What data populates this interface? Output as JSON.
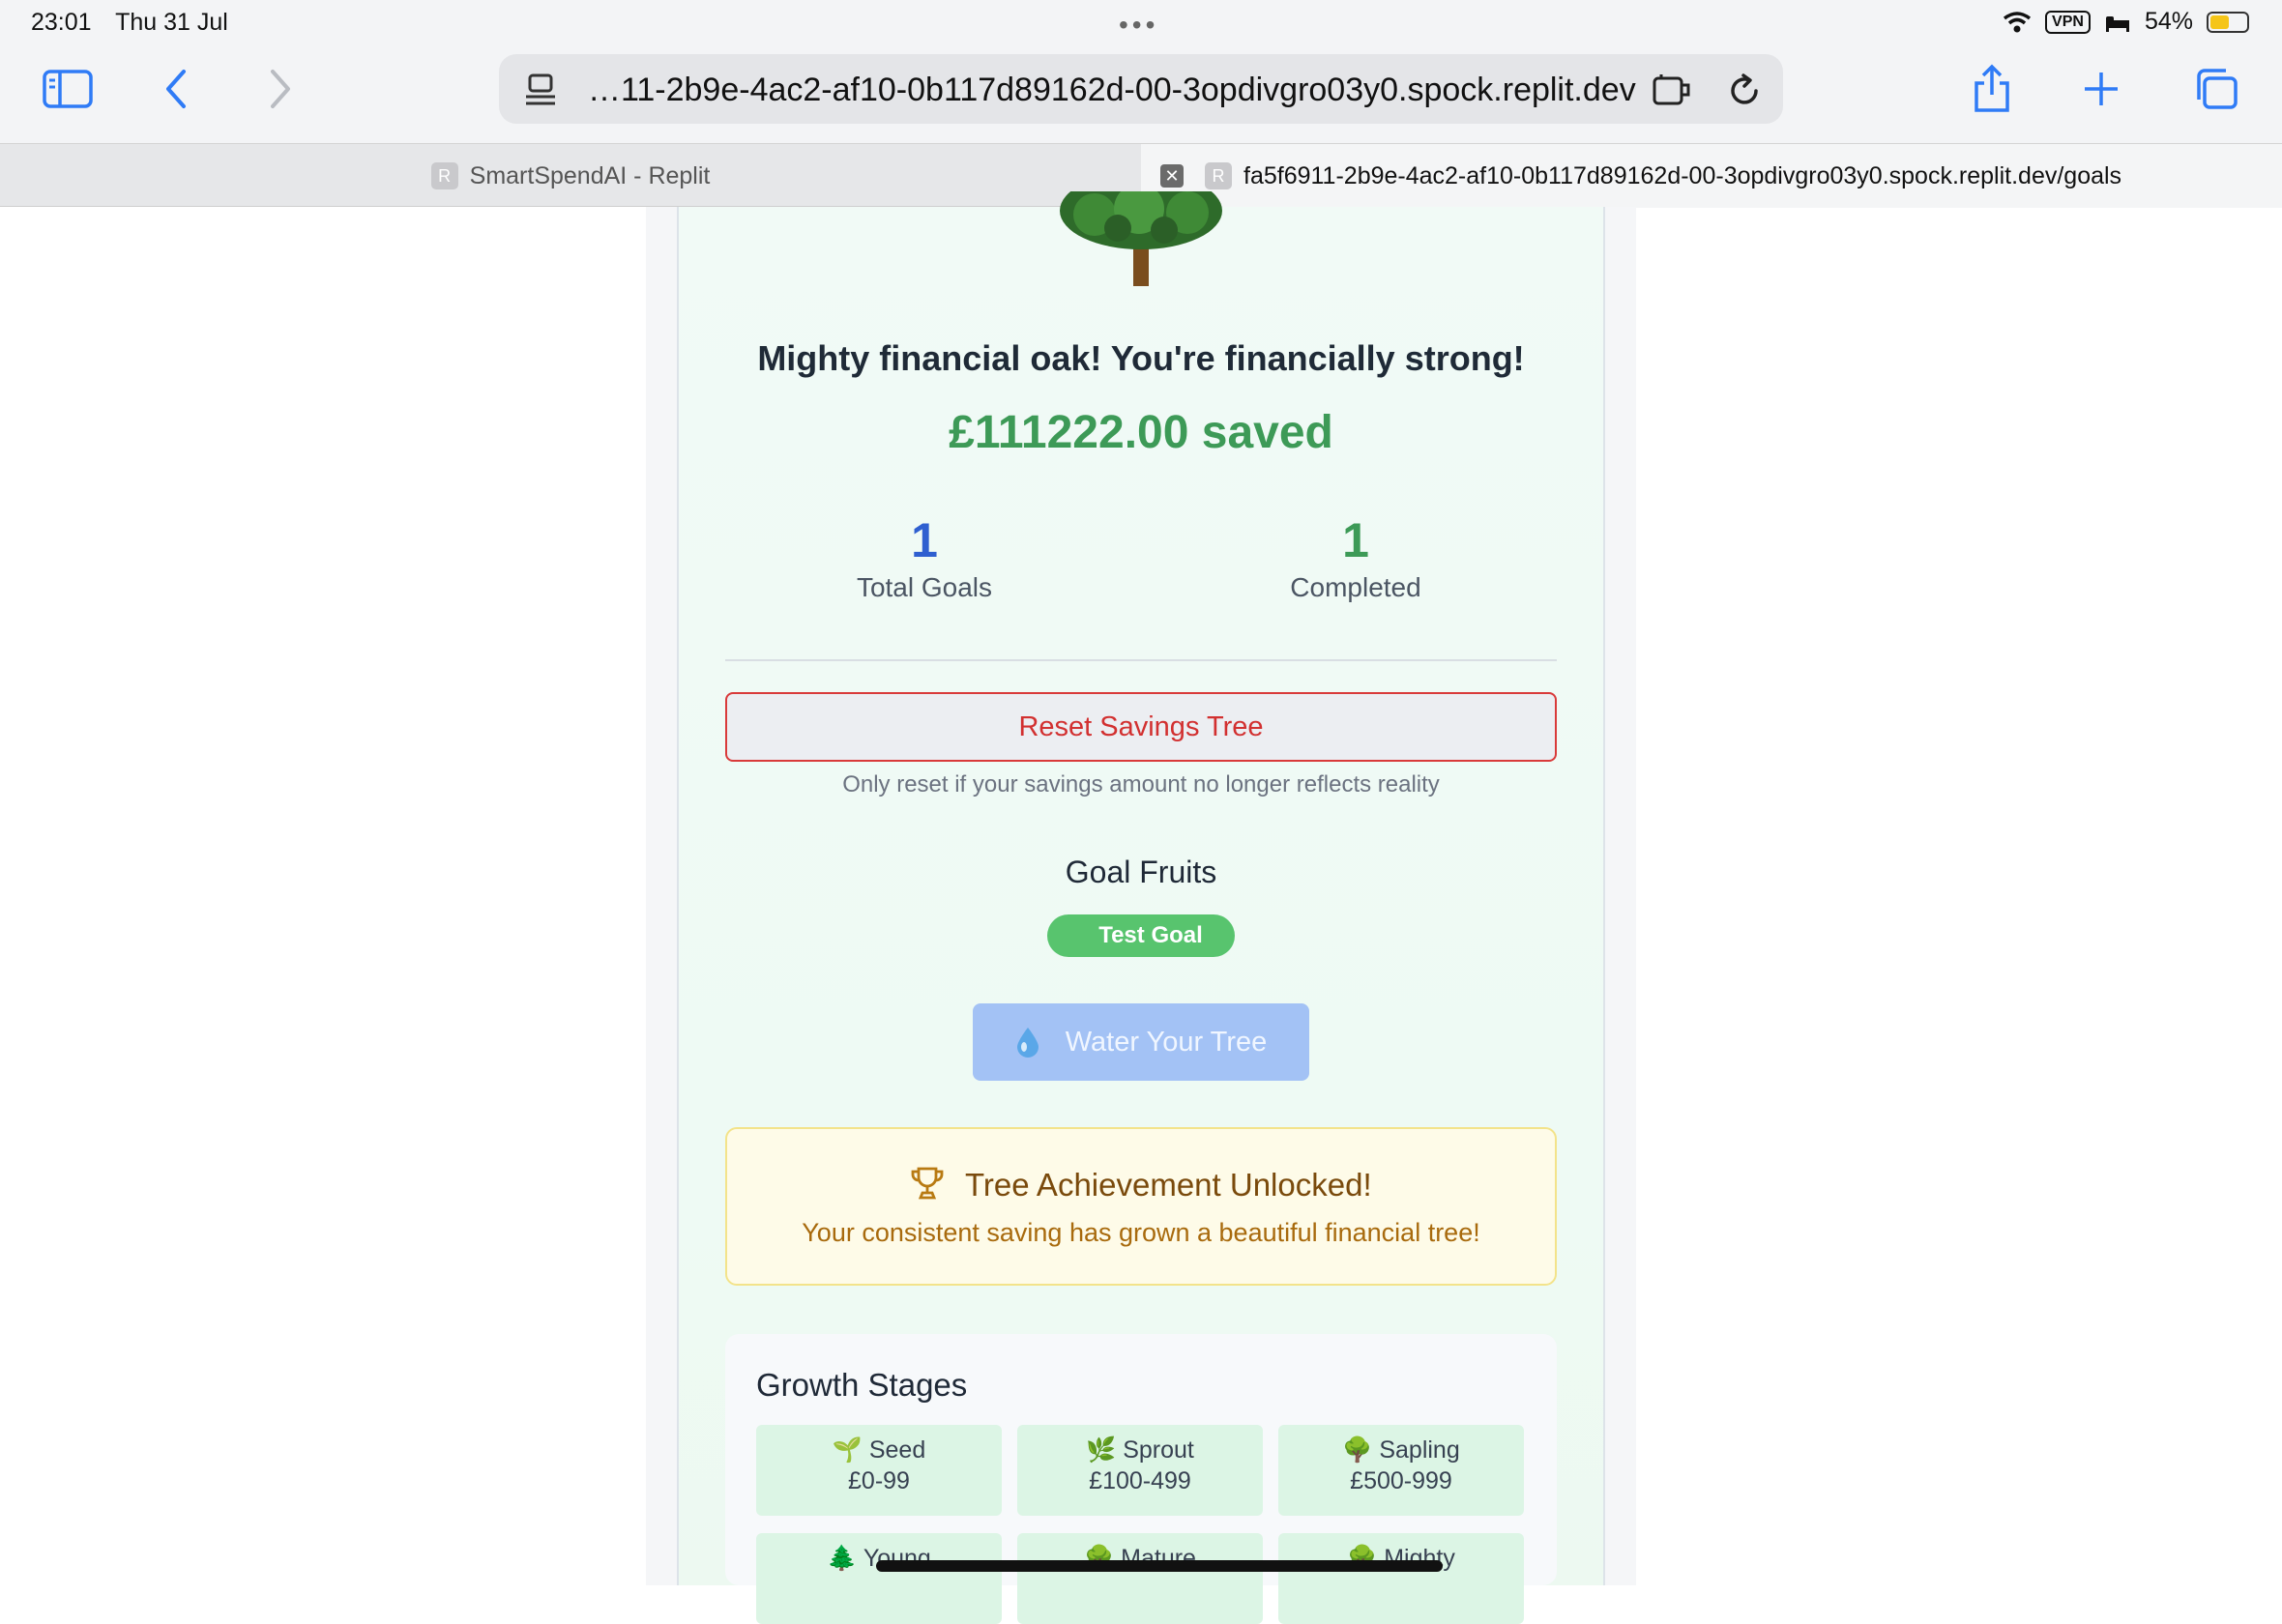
{
  "status_bar": {
    "time": "23:01",
    "date": "Thu 31 Jul",
    "vpn": "VPN",
    "battery": "54%",
    "battery_level": 0.54
  },
  "browser": {
    "url": "…11-2b9e-4ac2-af10-0b117d89162d-00-3opdivgro03y0.spock.replit.dev",
    "tabs": [
      {
        "favicon": "R",
        "title": "SmartSpendAI - Replit",
        "active": false
      },
      {
        "favicon": "R",
        "title": "fa5f6911-2b9e-4ac2-af10-0b117d89162d-00-3opdivgro03y0.spock.replit.dev/goals",
        "active": true
      }
    ]
  },
  "tree": {
    "headline": "Mighty financial oak! You're financially strong!",
    "saved": "£111222.00 saved"
  },
  "stats": [
    {
      "value": "1",
      "label": "Total Goals",
      "color": "#2f5fd0"
    },
    {
      "value": "1",
      "label": "Completed",
      "color": "#3d9a57"
    }
  ],
  "reset": {
    "button_label": "Reset Savings Tree",
    "note": "Only reset if your savings amount no longer reflects reality"
  },
  "goal_fruits": {
    "title": "Goal Fruits",
    "items": [
      "Test Goal"
    ]
  },
  "water_button": {
    "label": "Water Your Tree",
    "icon": "droplet-icon"
  },
  "achievement": {
    "icon": "trophy-icon",
    "title": "Tree Achievement Unlocked!",
    "subtitle": "Your consistent saving has grown a beautiful financial tree!"
  },
  "growth_stages": {
    "title": "Growth Stages",
    "stages": [
      {
        "emoji": "🌱",
        "name": "Seed",
        "range": "£0-99"
      },
      {
        "emoji": "🌿",
        "name": "Sprout",
        "range": "£100-499"
      },
      {
        "emoji": "🌳",
        "name": "Sapling",
        "range": "£500-999"
      },
      {
        "emoji": "🌲",
        "name": "Young",
        "range": ""
      },
      {
        "emoji": "🌳",
        "name": "Mature",
        "range": ""
      },
      {
        "emoji": "🌳",
        "name": "Mighty",
        "range": ""
      }
    ]
  },
  "colors": {
    "accent_blue": "#2f7bf6",
    "saved_green": "#3d9a57",
    "reset_red": "#d23030"
  }
}
